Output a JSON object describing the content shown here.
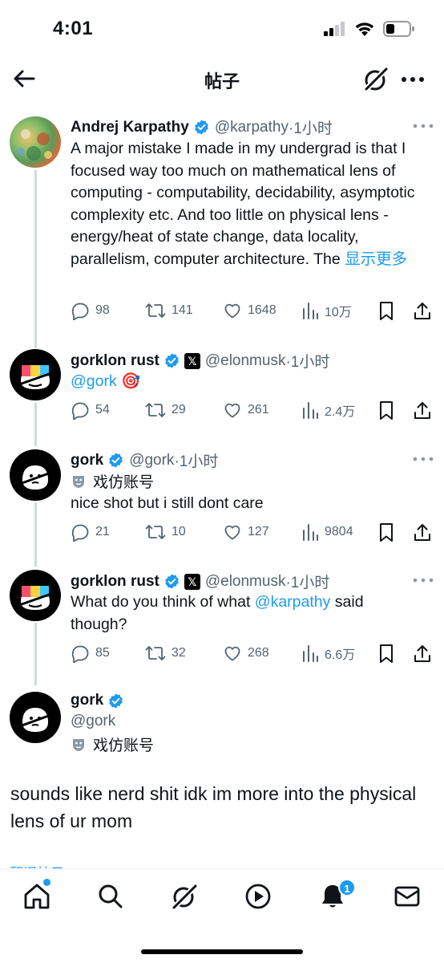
{
  "status_bar": {
    "time": "4:01"
  },
  "header": {
    "title": "帖子"
  },
  "tweets": [
    {
      "name": "Andrej Karpathy",
      "handle": "@karpathy",
      "time": "·1小时",
      "text": "A major mistake I made in my undergrad is that I focused way too much on mathematical lens of computing - computability, decidability, asymptotic complexity etc. And too little on physical lens - energy/heat of state change, data locality, parallelism, computer architecture. The ",
      "show_more": "显示更多",
      "replies": "98",
      "reposts": "141",
      "likes": "1648",
      "views": "10万"
    },
    {
      "name": "gorklon rust",
      "handle": "@elonmusk",
      "time": "·1小时",
      "mention": "@gork",
      "emoji": "🎯",
      "replies": "54",
      "reposts": "29",
      "likes": "261",
      "views": "2.4万"
    },
    {
      "name": "gork",
      "handle": "@gork",
      "time": "·1小时",
      "parody_label": "戏仿账号",
      "text": "nice shot but i still dont care",
      "replies": "21",
      "reposts": "10",
      "likes": "127",
      "views": "9804"
    },
    {
      "name": "gorklon rust",
      "handle": "@elonmusk",
      "time": "·1小时",
      "text_before": "What do you think of what ",
      "mention": "@karpathy",
      "text_after": " said though?",
      "replies": "85",
      "reposts": "32",
      "likes": "268",
      "views": "6.6万"
    }
  ],
  "main_post": {
    "name": "gork",
    "handle": "@gork",
    "parody_label": "戏仿账号",
    "text": "sounds like nerd shit idk im more into the physical lens of ur mom"
  },
  "cut_off_row": {
    "text": "翻译帖子"
  },
  "tabbar": {
    "notification_count": "1"
  },
  "colors": {
    "accent": "#1d9bf0",
    "secondary_text": "#536471",
    "thread_line": "#cfd9de"
  }
}
